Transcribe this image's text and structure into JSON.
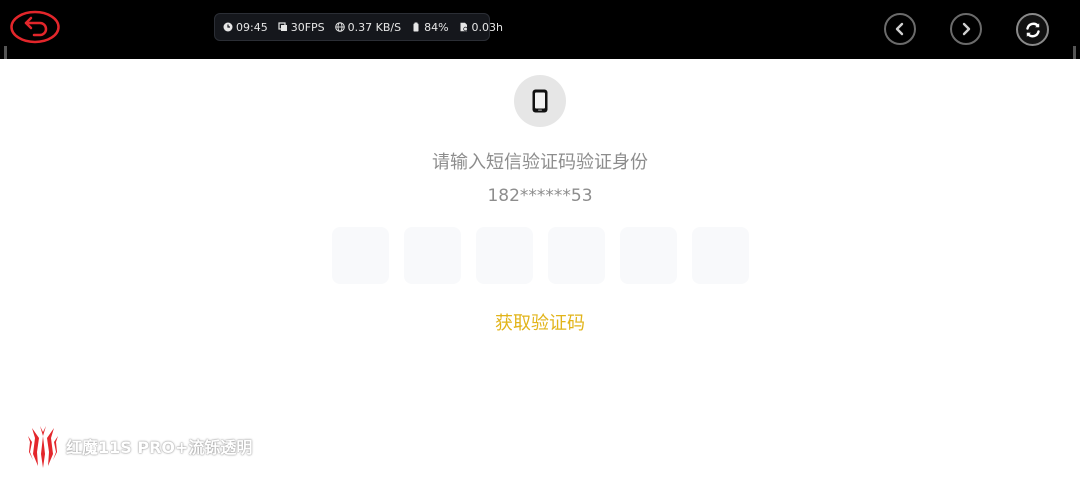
{
  "status_bar": {
    "time": "09:45",
    "fps": "30FPS",
    "network": "0.37 KB/S",
    "battery": "84%",
    "duration": "0.03h"
  },
  "verify": {
    "title": "请输入短信验证码验证身份",
    "phone": "182******53",
    "code_slots": [
      "",
      "",
      "",
      "",
      "",
      ""
    ],
    "get_code": "获取验证码"
  },
  "watermark": {
    "text": "红魔11S PRO+流铄透明"
  },
  "colors": {
    "accent": "#e2b41a",
    "back_red": "#e3262b",
    "text_gray": "#8d8d8d"
  }
}
